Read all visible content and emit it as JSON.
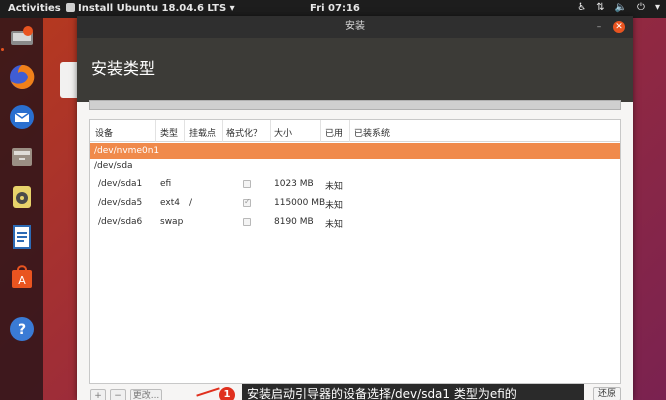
{
  "topbar": {
    "activities": "Activities",
    "app_menu": "Install Ubuntu 18.04.6 LTS ▾",
    "clock": "Fri 07:16"
  },
  "dock": {
    "items": [
      "installer-icon",
      "firefox-icon",
      "thunderbird-icon",
      "files-icon",
      "rhythmbox-icon",
      "writer-icon",
      "software-center-icon",
      "help-icon"
    ]
  },
  "window": {
    "title": "安装",
    "heading": "安装类型"
  },
  "table": {
    "headers": [
      "设备",
      "类型",
      "挂载点",
      "格式化？",
      "大小",
      "已用",
      "已装系统"
    ],
    "rows": [
      {
        "device": "/dev/nvme0n1",
        "type": "",
        "mount": "",
        "format": null,
        "size": "",
        "used": "",
        "system": "",
        "selected": true
      },
      {
        "device": "/dev/sda",
        "type": "",
        "mount": "",
        "format": null,
        "size": "",
        "used": "",
        "system": "",
        "selected": false
      },
      {
        "device": "/dev/sda1",
        "type": "efi",
        "mount": "",
        "format": false,
        "size": "1023 MB",
        "used": "未知",
        "system": "",
        "selected": false
      },
      {
        "device": "/dev/sda5",
        "type": "ext4",
        "mount": "/",
        "format": true,
        "size": "115000 MB",
        "used": "未知",
        "system": "",
        "selected": false
      },
      {
        "device": "/dev/sda6",
        "type": "swap",
        "mount": "",
        "format": false,
        "size": "8190 MB",
        "used": "未知",
        "system": "",
        "selected": false
      }
    ]
  },
  "toolbar": {
    "add": "+",
    "remove": "−",
    "change": "更改..."
  },
  "callout": {
    "badge": "1",
    "text": "安装启动引导器的设备选择/dev/sda1 类型为efi的"
  },
  "revert_button": "还原",
  "colors": {
    "accent": "#e95420",
    "selected_row": "#f08a4b",
    "header_bg": "#3c3b37"
  }
}
